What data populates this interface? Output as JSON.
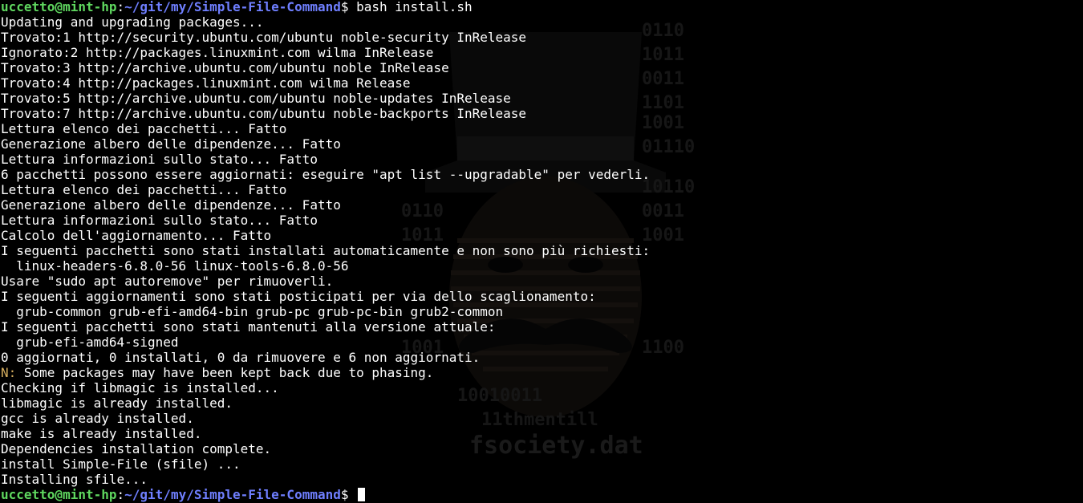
{
  "prompt": {
    "user_host": "uccetto@mint-hp",
    "colon": ":",
    "path": "~/git/my/Simple-File-Command",
    "symbol": "$ "
  },
  "command": "bash install.sh",
  "output": [
    "Updating and upgrading packages...",
    "Trovato:1 http://security.ubuntu.com/ubuntu noble-security InRelease",
    "Ignorato:2 http://packages.linuxmint.com wilma InRelease",
    "Trovato:3 http://archive.ubuntu.com/ubuntu noble InRelease",
    "Trovato:4 http://packages.linuxmint.com wilma Release",
    "Trovato:5 http://archive.ubuntu.com/ubuntu noble-updates InRelease",
    "Trovato:7 http://archive.ubuntu.com/ubuntu noble-backports InRelease",
    "Lettura elenco dei pacchetti... Fatto",
    "Generazione albero delle dipendenze... Fatto",
    "Lettura informazioni sullo stato... Fatto",
    "6 pacchetti possono essere aggiornati: eseguire \"apt list --upgradable\" per vederli.",
    "Lettura elenco dei pacchetti... Fatto",
    "Generazione albero delle dipendenze... Fatto",
    "Lettura informazioni sullo stato... Fatto",
    "Calcolo dell'aggiornamento... Fatto",
    "I seguenti pacchetti sono stati installati automaticamente e non sono più richiesti:",
    "  linux-headers-6.8.0-56 linux-tools-6.8.0-56",
    "Usare \"sudo apt autoremove\" per rimuoverli.",
    "I seguenti aggiornamenti sono stati posticipati per via dello scaglionamento:",
    "  grub-common grub-efi-amd64-bin grub-pc grub-pc-bin grub2-common",
    "I seguenti pacchetti sono stati mantenuti alla versione attuale:",
    "  grub-efi-amd64-signed",
    "0 aggiornati, 0 installati, 0 da rimuovere e 6 non aggiornati."
  ],
  "notice": {
    "prefix": "N:",
    "text": " Some packages may have been kept back due to phasing."
  },
  "output_tail": [
    "Checking if libmagic is installed...",
    "libmagic is already installed.",
    "gcc is already installed.",
    "make is already installed.",
    "Dependencies installation complete.",
    "install Simple-File (sfile) ...",
    "Installing sfile..."
  ],
  "wallpaper": {
    "caption": "fsociety.dat",
    "binary_rows": [
      "0110",
      "1011",
      "0011",
      "1101",
      "1001",
      "01110",
      "10110",
      "0011",
      "1001",
      "1100",
      "0110",
      "1011",
      "1001",
      "10010011",
      "11thmentill"
    ]
  },
  "colors": {
    "background": "#000000",
    "text": "#ffffff",
    "prompt_user": "#5fd75f",
    "prompt_path": "#6f7fff",
    "notice": "#d7af5f"
  }
}
